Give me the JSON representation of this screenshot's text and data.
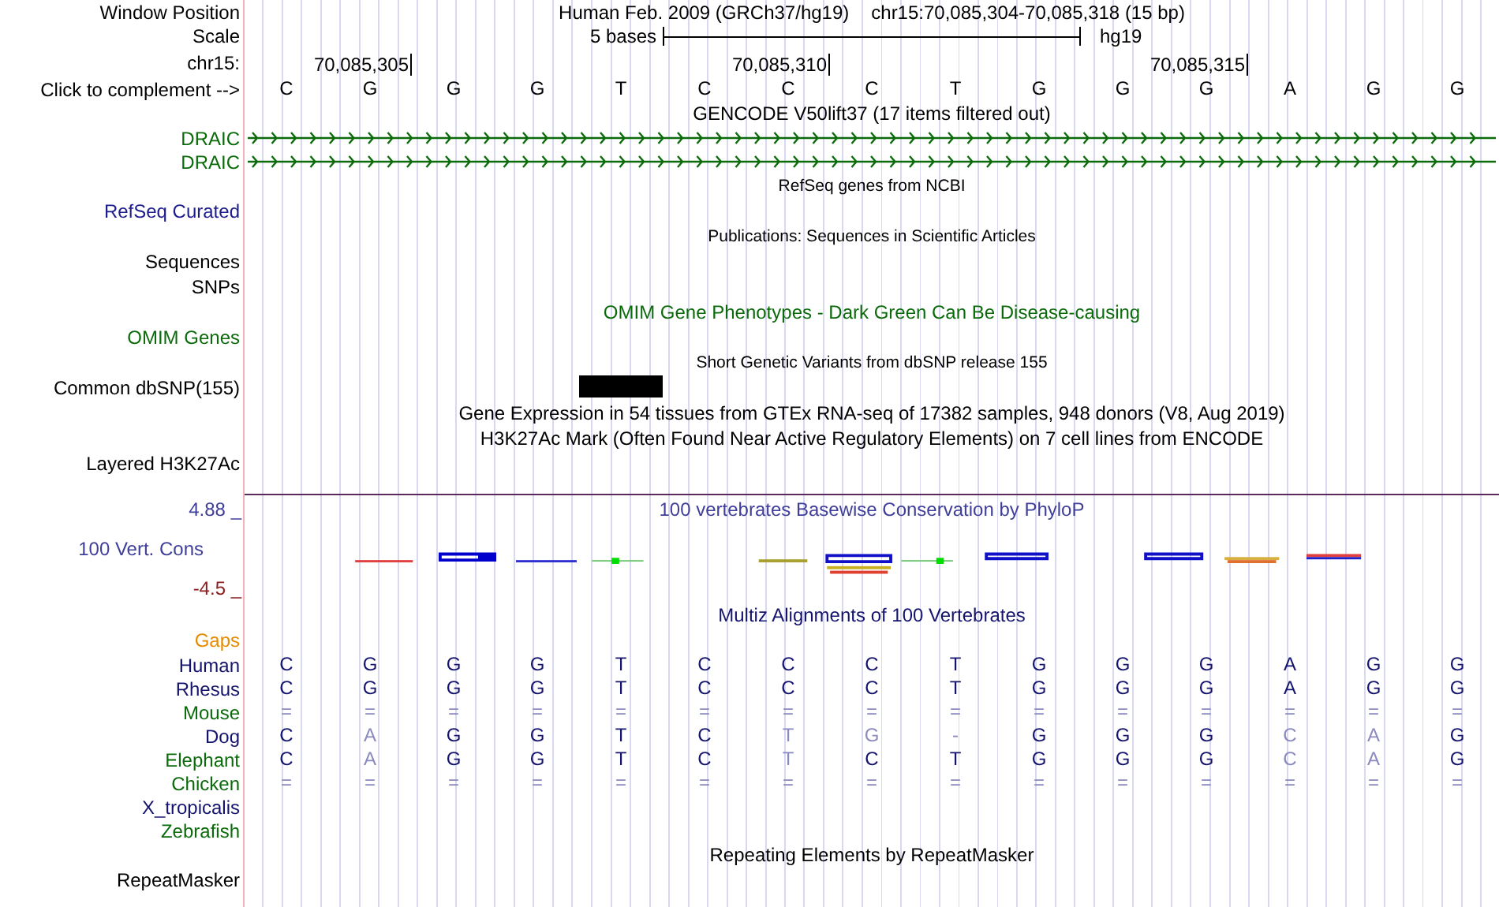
{
  "header": {
    "position_label": "Window Position",
    "assembly": "Human Feb. 2009 (GRCh37/hg19)",
    "range": "chr15:70,085,304-70,085,318 (15 bp)",
    "scale_label": "Scale",
    "scale_text": "5 bases",
    "scale_assembly": "hg19",
    "chrom_label": "chr15:",
    "ticks": [
      "70,085,305",
      "70,085,310",
      "70,085,315"
    ],
    "bases_label": "Click to complement -->",
    "bases": [
      "C",
      "G",
      "G",
      "G",
      "T",
      "C",
      "C",
      "C",
      "T",
      "G",
      "G",
      "G",
      "A",
      "G",
      "G"
    ]
  },
  "tracks": [
    {
      "kind": "title",
      "text": "GENCODE V50lift37 (17 items filtered out)",
      "color": "#000000"
    },
    {
      "kind": "arrows",
      "label": "DRAIC",
      "color": "#0b6b0b"
    },
    {
      "kind": "arrows",
      "label": "DRAIC",
      "color": "#0b6b0b"
    },
    {
      "kind": "note",
      "text": "RefSeq genes from NCBI",
      "color": "#000000"
    },
    {
      "kind": "label",
      "label": "RefSeq Curated",
      "color": "#1c1c8c"
    },
    {
      "kind": "note",
      "text": "Publications: Sequences in Scientific Articles",
      "color": "#000000"
    },
    {
      "kind": "label",
      "label": "Sequences",
      "color": "#000000"
    },
    {
      "kind": "label",
      "label": "SNPs",
      "color": "#000000"
    },
    {
      "kind": "title",
      "text": "OMIM Gene Phenotypes - Dark Green Can Be Disease-causing",
      "color": "#0b6b0b"
    },
    {
      "kind": "label",
      "label": "OMIM Genes",
      "color": "#0b6b0b"
    },
    {
      "kind": "note",
      "text": "Short Genetic Variants from dbSNP release 155",
      "color": "#000000"
    },
    {
      "kind": "snp",
      "label": "Common dbSNP(155)",
      "color": "#000000"
    },
    {
      "kind": "title",
      "text": "Gene Expression in 54 tissues from GTEx RNA-seq of 17382 samples, 948 donors (V8, Aug 2019)",
      "color": "#000000"
    },
    {
      "kind": "title",
      "text": "H3K27Ac Mark (Often Found Near Active Regulatory Elements) on 7 cell lines from ENCODE",
      "color": "#000000"
    },
    {
      "kind": "label",
      "label": "Layered H3K27Ac",
      "color": "#000000"
    },
    {
      "kind": "divider"
    },
    {
      "kind": "wiggle",
      "ymax": "4.88 _",
      "label": "100 Vert. Cons",
      "ymin": "-4.5 _",
      "title": "100 vertebrates Basewise Conservation by PhyloP",
      "color": "#3f3f9a"
    },
    {
      "kind": "title",
      "text": "Multiz Alignments of 100 Vertebrates",
      "color": "#14146e"
    },
    {
      "kind": "label",
      "label": "Gaps",
      "color": "#e68a00"
    },
    {
      "kind": "alignment",
      "label": "Human",
      "color": "#14146e",
      "bases": [
        "C",
        "G",
        "G",
        "G",
        "T",
        "C",
        "C",
        "C",
        "T",
        "G",
        "G",
        "G",
        "A",
        "G",
        "G"
      ],
      "faint": [
        false,
        false,
        false,
        false,
        false,
        false,
        false,
        false,
        false,
        false,
        false,
        false,
        false,
        false,
        false
      ]
    },
    {
      "kind": "alignment",
      "label": "Rhesus",
      "color": "#14146e",
      "bases": [
        "C",
        "G",
        "G",
        "G",
        "T",
        "C",
        "C",
        "C",
        "T",
        "G",
        "G",
        "G",
        "A",
        "G",
        "G"
      ],
      "faint": [
        false,
        false,
        false,
        false,
        false,
        false,
        false,
        false,
        false,
        false,
        false,
        false,
        false,
        false,
        false
      ]
    },
    {
      "kind": "alignment",
      "label": "Mouse",
      "color": "#0b6b0b",
      "bases": [
        "=",
        "=",
        "=",
        "=",
        "=",
        "=",
        "=",
        "=",
        "=",
        "=",
        "=",
        "=",
        "=",
        "=",
        "="
      ],
      "faint": [
        true,
        true,
        true,
        true,
        true,
        true,
        true,
        true,
        true,
        true,
        true,
        true,
        true,
        true,
        true
      ]
    },
    {
      "kind": "alignment",
      "label": "Dog",
      "color": "#14146e",
      "bases": [
        "C",
        "A",
        "G",
        "G",
        "T",
        "C",
        "T",
        "G",
        "-",
        "G",
        "G",
        "G",
        "C",
        "A",
        "G"
      ],
      "faint": [
        false,
        true,
        false,
        false,
        false,
        false,
        true,
        true,
        true,
        false,
        false,
        false,
        true,
        true,
        false
      ]
    },
    {
      "kind": "alignment",
      "label": "Elephant",
      "color": "#0b6b0b",
      "bases": [
        "C",
        "A",
        "G",
        "G",
        "T",
        "C",
        "T",
        "C",
        "T",
        "G",
        "G",
        "G",
        "C",
        "A",
        "G"
      ],
      "faint": [
        false,
        true,
        false,
        false,
        false,
        false,
        true,
        false,
        false,
        false,
        false,
        false,
        true,
        true,
        false
      ]
    },
    {
      "kind": "alignment",
      "label": "Chicken",
      "color": "#0b6b0b",
      "bases": [
        "=",
        "=",
        "=",
        "=",
        "=",
        "=",
        "=",
        "=",
        "=",
        "=",
        "=",
        "=",
        "=",
        "=",
        "="
      ],
      "faint": [
        true,
        true,
        true,
        true,
        true,
        true,
        true,
        true,
        true,
        true,
        true,
        true,
        true,
        true,
        true
      ]
    },
    {
      "kind": "alignment",
      "label": "X_tropicalis",
      "color": "#14146e"
    },
    {
      "kind": "alignment",
      "label": "Zebrafish",
      "color": "#0b6b0b"
    },
    {
      "kind": "title",
      "text": "Repeating Elements by RepeatMasker",
      "color": "#000000"
    },
    {
      "kind": "label",
      "label": "RepeatMasker",
      "color": "#000000"
    }
  ]
}
